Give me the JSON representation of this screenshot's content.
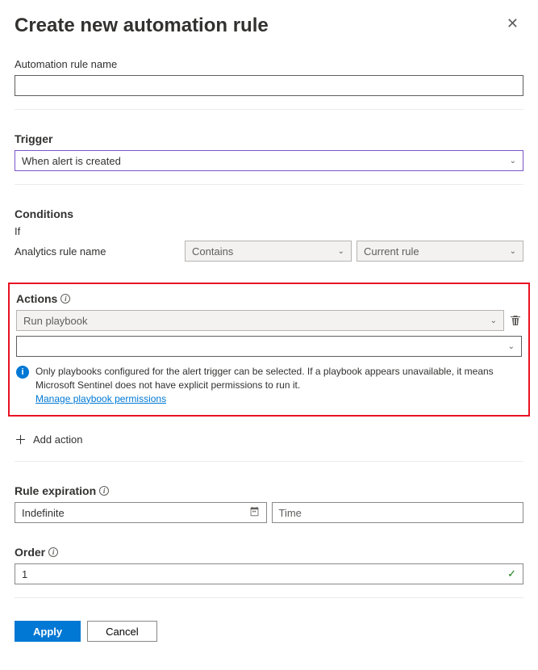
{
  "header": {
    "title": "Create new automation rule"
  },
  "rule_name": {
    "label": "Automation rule name",
    "value": ""
  },
  "trigger": {
    "heading": "Trigger",
    "selected": "When alert is created"
  },
  "conditions": {
    "heading": "Conditions",
    "if_label": "If",
    "field_label": "Analytics rule name",
    "operator": "Contains",
    "value": "Current rule"
  },
  "actions": {
    "heading": "Actions",
    "type_selected": "Run playbook",
    "playbook_selected": "",
    "info_text": "Only playbooks configured for the alert trigger can be selected. If a playbook appears unavailable, it means Microsoft Sentinel does not have explicit permissions to run it.",
    "permissions_link": "Manage playbook permissions",
    "add_action_label": "Add action"
  },
  "expiration": {
    "heading": "Rule expiration",
    "date_value": "Indefinite",
    "time_placeholder": "Time"
  },
  "order": {
    "heading": "Order",
    "value": "1"
  },
  "footer": {
    "apply": "Apply",
    "cancel": "Cancel"
  }
}
